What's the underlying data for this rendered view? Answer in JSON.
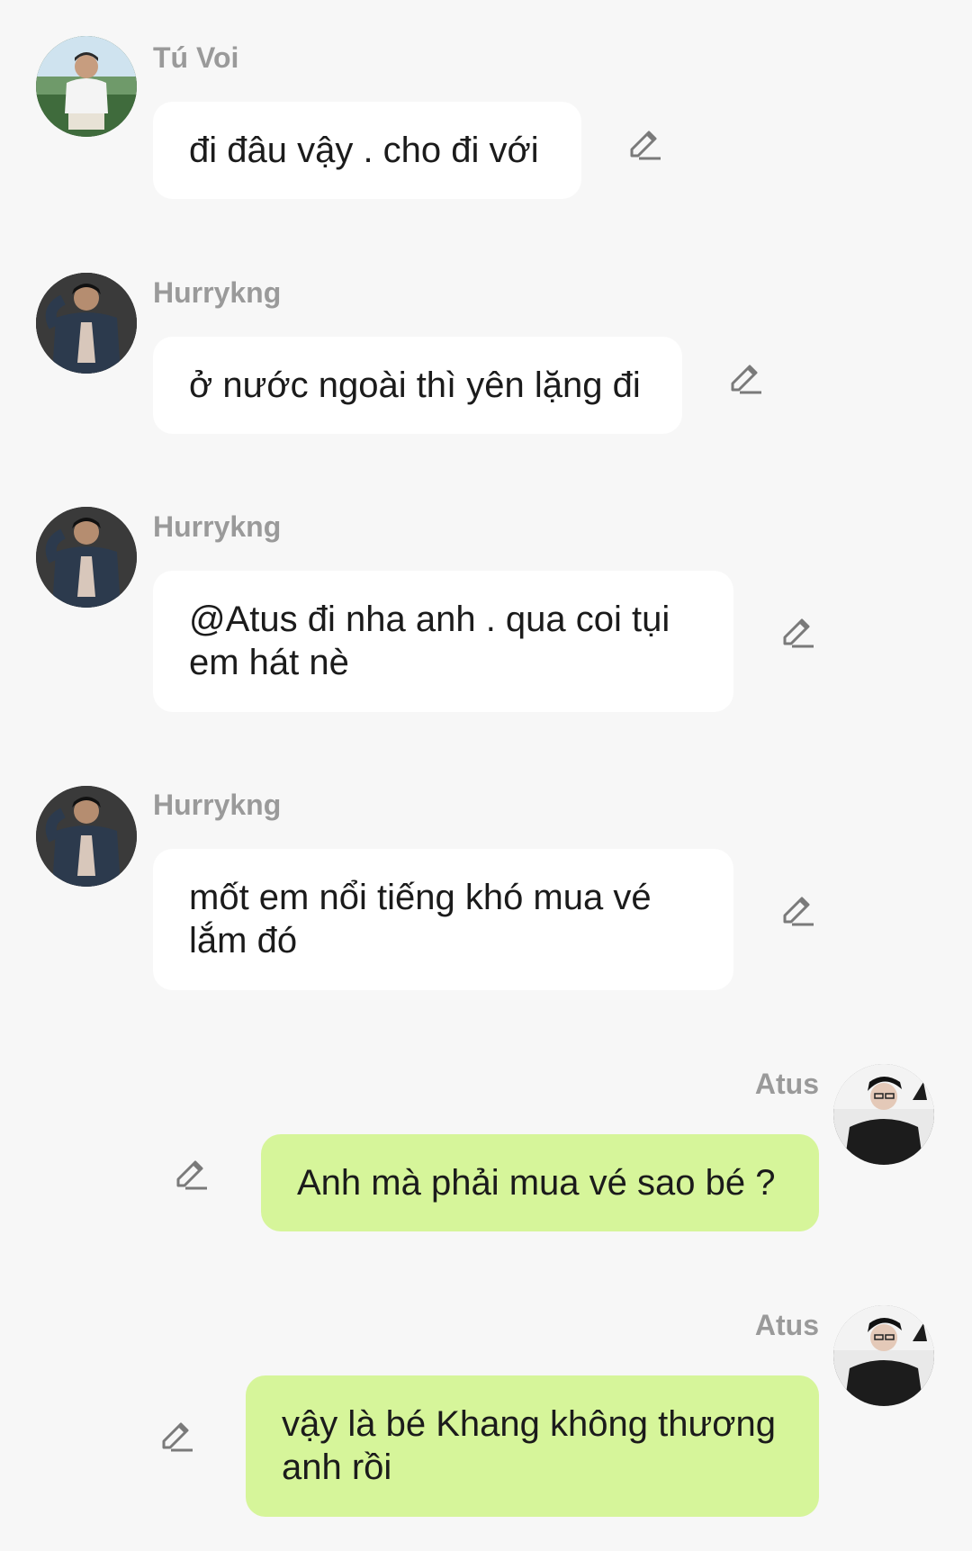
{
  "messages": [
    {
      "sender": "Tú Voi",
      "text": "đi đâu vậy . cho đi với",
      "direction": "incoming",
      "avatar": "tu-voi-avatar"
    },
    {
      "sender": "Hurrykng",
      "text": "ở nước ngoài thì yên lặng đi",
      "direction": "incoming",
      "avatar": "hurrykng-avatar"
    },
    {
      "sender": "Hurrykng",
      "text": "@Atus đi nha anh . qua coi tụi em hát nè",
      "direction": "incoming",
      "avatar": "hurrykng-avatar"
    },
    {
      "sender": "Hurrykng",
      "text": "mốt em nổi tiếng khó mua vé lắm đó",
      "direction": "incoming",
      "avatar": "hurrykng-avatar"
    },
    {
      "sender": "Atus",
      "text": "Anh mà phải mua vé sao bé ?",
      "direction": "outgoing",
      "avatar": "atus-avatar"
    },
    {
      "sender": "Atus",
      "text": "vậy là bé Khang không thương anh rồi",
      "direction": "outgoing",
      "avatar": "atus-avatar"
    }
  ],
  "icons": {
    "edit": "pencil-edit-icon"
  },
  "colors": {
    "background": "#f7f7f7",
    "incoming_bubble": "#ffffff",
    "outgoing_bubble": "#d6f59a",
    "sender_name": "#9a9a9a",
    "edit_icon": "#7a7a7a"
  }
}
